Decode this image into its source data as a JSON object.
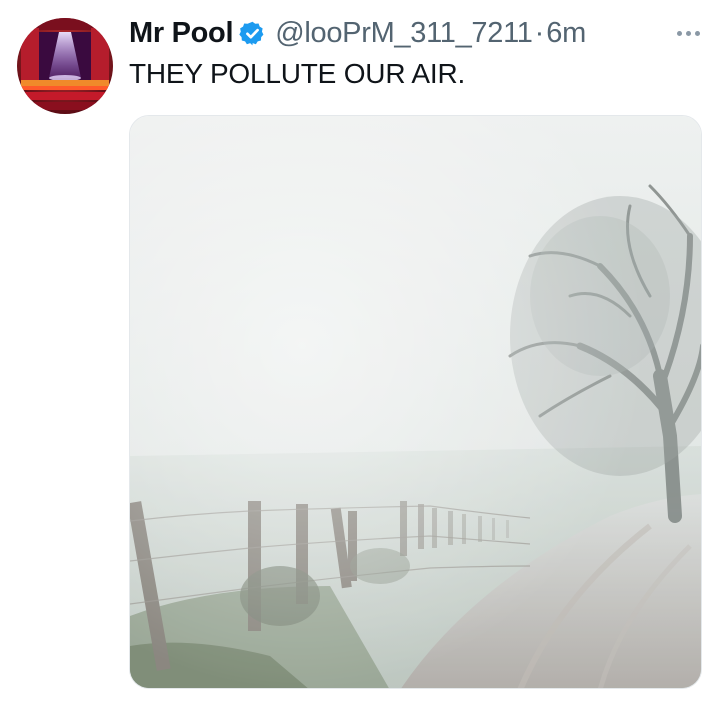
{
  "tweet": {
    "author_name": "Mr Pool",
    "handle": "@looPrM_311_7211",
    "separator": "·",
    "time_ago": "6m",
    "text": "THEY POLLUTE OUR AIR.",
    "verified_color": "#1d9bf0",
    "more_icon": "more-horizontal-icon"
  },
  "media": {
    "description_icon": "foggy-country-road-photo"
  }
}
